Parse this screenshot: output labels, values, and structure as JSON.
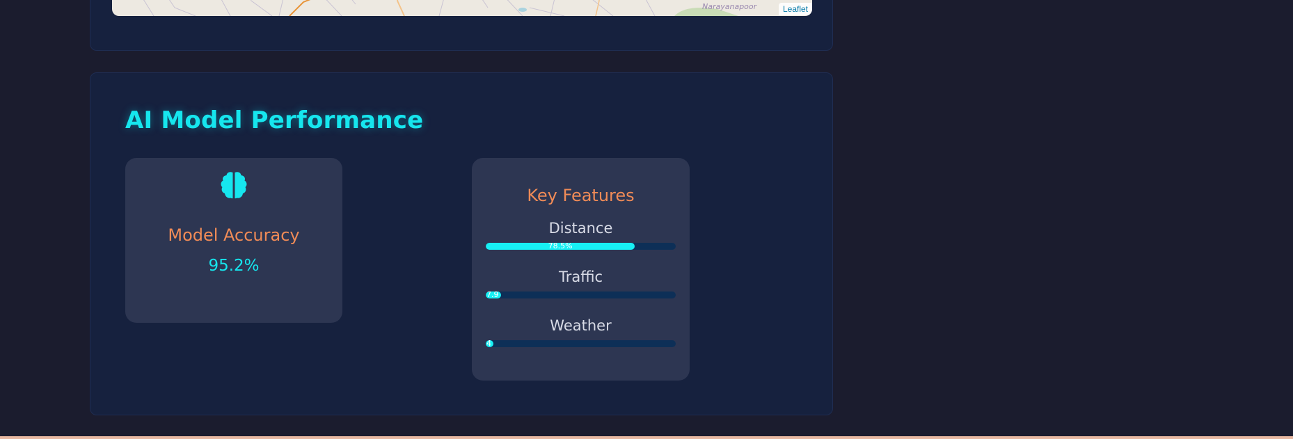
{
  "map": {
    "place_label": "Narayanapoor",
    "attribution": "Leaflet"
  },
  "performance": {
    "title": "AI Model Performance",
    "accuracy_card": {
      "icon": "brain-icon",
      "label": "Model Accuracy",
      "value": "95.2%"
    },
    "features_card": {
      "title": "Key Features",
      "features": [
        {
          "name": "Distance",
          "value_label": "78.5%",
          "fraction": 0.785
        },
        {
          "name": "Traffic",
          "value_label": "7.9",
          "fraction": 0.079
        },
        {
          "name": "Weather",
          "value_label": "4",
          "fraction": 0.04
        }
      ]
    }
  },
  "colors": {
    "accent_cyan": "#16e6ee",
    "accent_orange": "#f08b57",
    "panel_bg": "#16213e",
    "card_bg": "#2d3652"
  }
}
